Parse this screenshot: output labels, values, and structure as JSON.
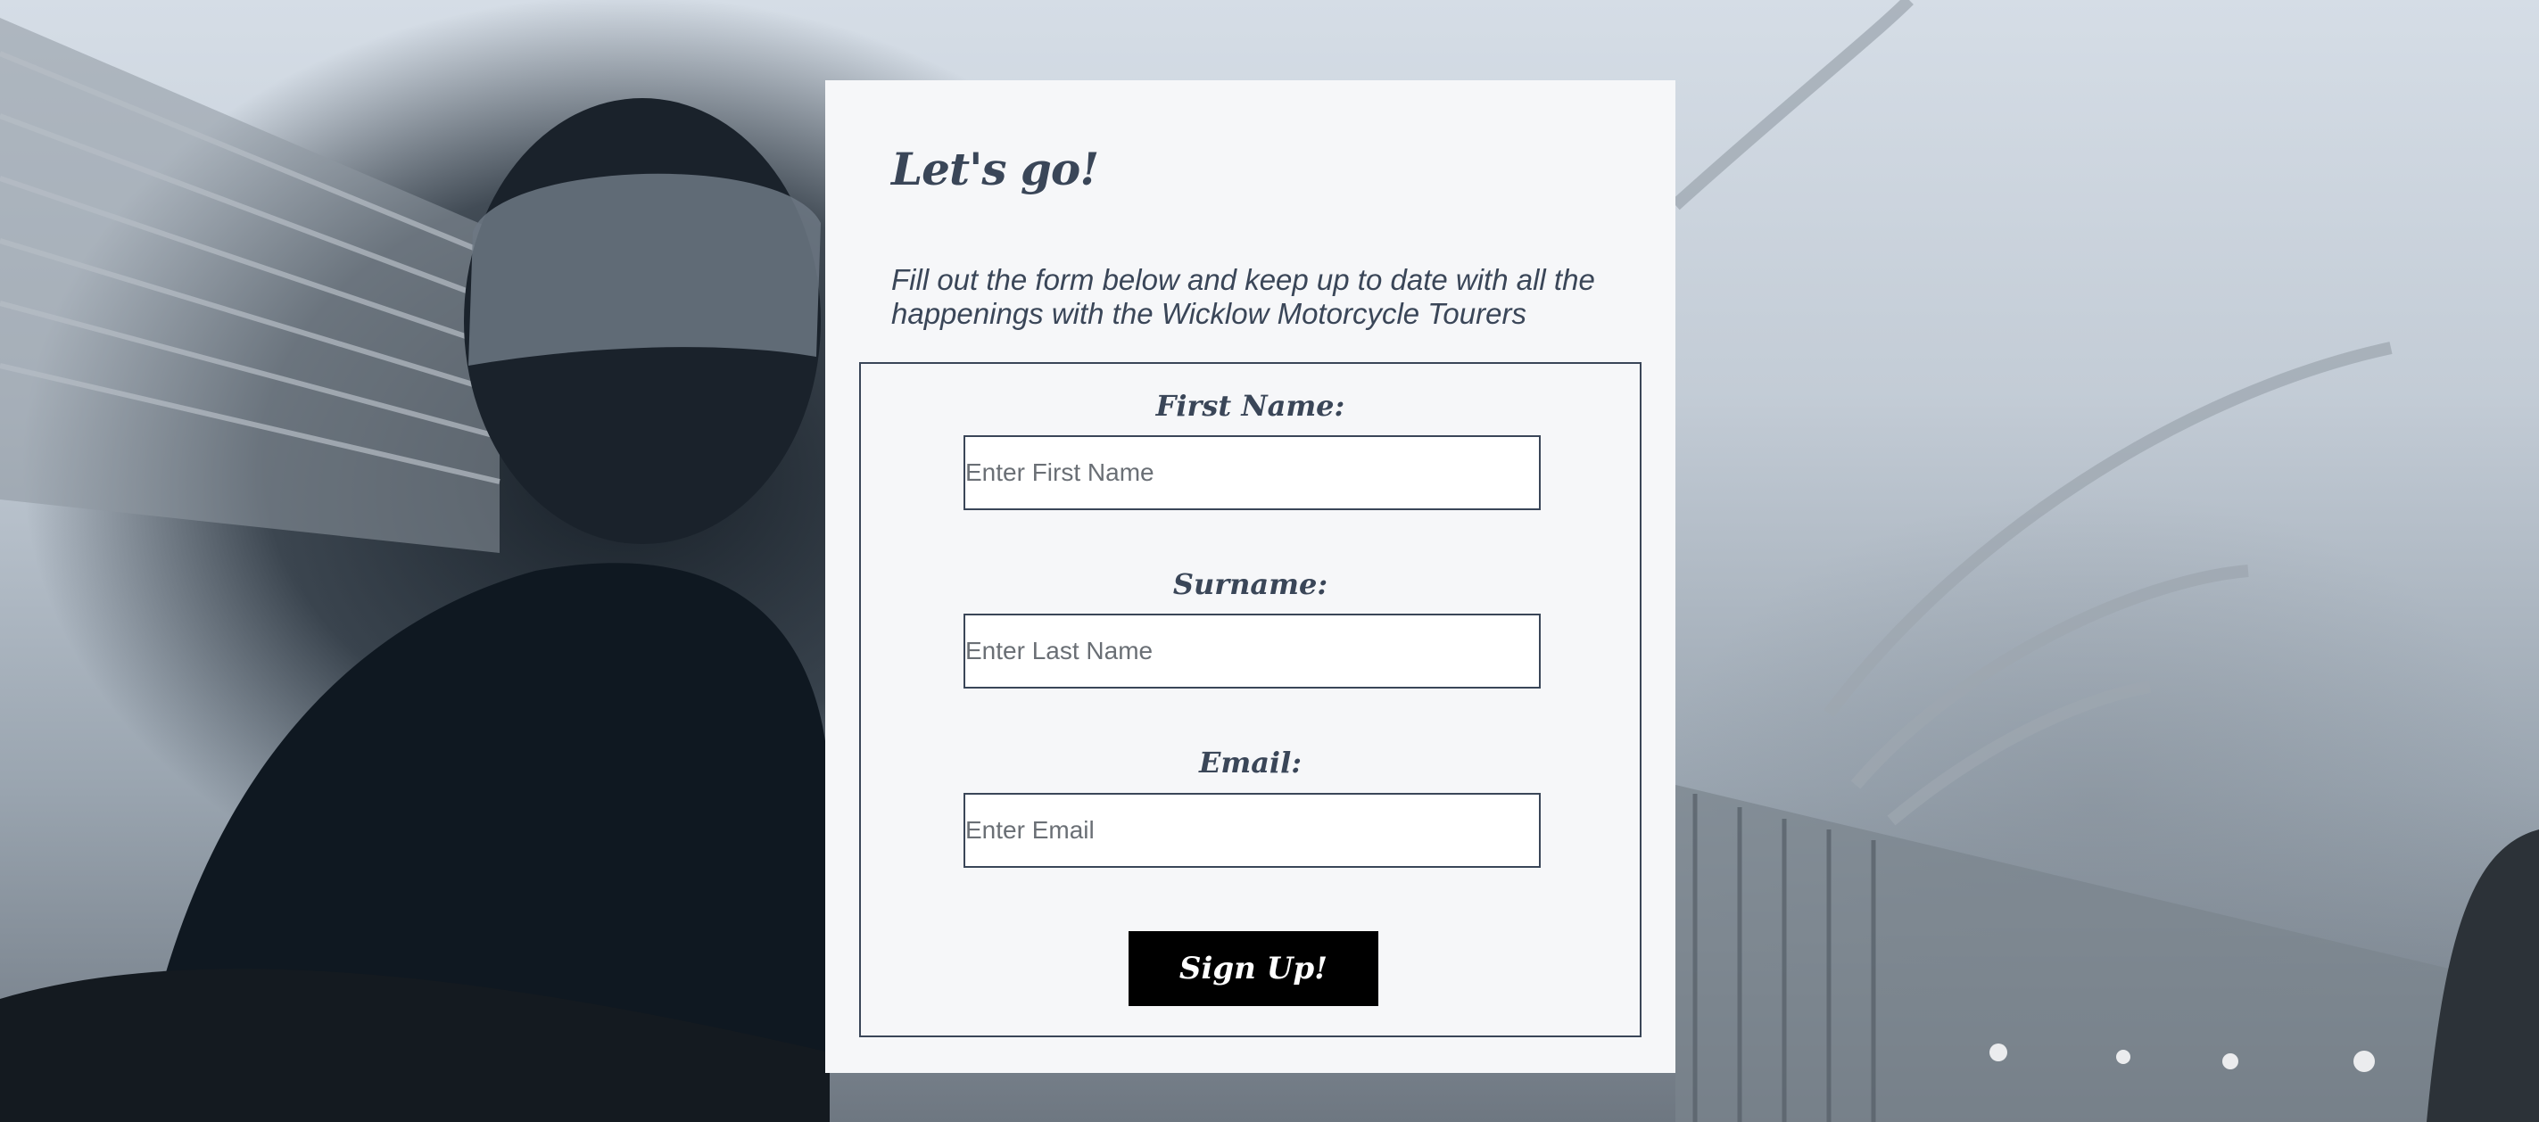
{
  "card": {
    "title": "Let's go!",
    "intro": "Fill out the form below and keep up to date with all the happenings with the Wicklow Motorcycle Tourers"
  },
  "form": {
    "first_name": {
      "label": "First Name:",
      "placeholder": "Enter First Name",
      "value": ""
    },
    "surname": {
      "label": "Surname:",
      "placeholder": "Enter Last Name",
      "value": ""
    },
    "email": {
      "label": "Email:",
      "placeholder": "Enter Email",
      "value": ""
    },
    "submit_label": "Sign Up!"
  },
  "colors": {
    "text": "#3a4658",
    "card_background": "#f6f7f9",
    "button_background": "#000000",
    "button_text": "#ffffff"
  }
}
